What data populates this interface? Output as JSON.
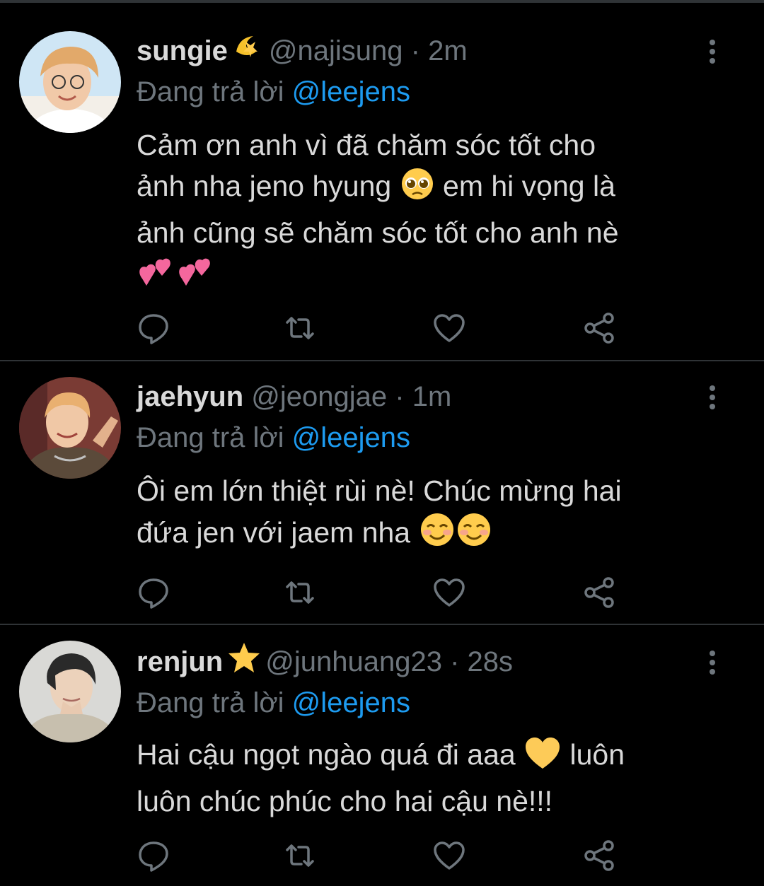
{
  "colors": {
    "background": "#000000",
    "text": "#d9d9d9",
    "secondary": "#6e767d",
    "mention": "#1d9bf0",
    "divider": "#2f3336"
  },
  "tweets": [
    {
      "display_name": "sungie",
      "badge_icon": "dizzy-emoji",
      "handle": "@najisung",
      "time": "· 2m",
      "replying_prefix": "Đang trả lời",
      "replying_to": "@leejens",
      "lines": [
        "Cảm ơn anh vì đã chăm sóc tốt cho",
        "ảnh nha jeno hyung",
        "em hi vọng là",
        "ảnh cũng sẽ chăm sóc tốt cho anh nè"
      ],
      "emojis": [
        "pleading-face-emoji",
        "two-hearts-emoji",
        "two-hearts-emoji"
      ]
    },
    {
      "display_name": "jaehyun",
      "handle": "@jeongjae",
      "time": "· 1m",
      "replying_prefix": "Đang trả lời",
      "replying_to": "@leejens",
      "lines": [
        "Ôi em lớn thiệt rùi nè! Chúc mừng hai",
        "đứa jen với jaem nha"
      ],
      "emojis": [
        "smiling-face-emoji",
        "smiling-face-emoji"
      ]
    },
    {
      "display_name": "renjun",
      "badge_icon": "star-emoji",
      "handle": "@junhuang23",
      "time": "· 28s",
      "replying_prefix": "Đang trả lời",
      "replying_to": "@leejens",
      "lines": [
        "Hai cậu ngọt ngào quá đi aaa",
        "luôn",
        "luôn chúc phúc cho hai cậu nè!!!"
      ],
      "emojis": [
        "yellow-heart-emoji"
      ]
    }
  ],
  "action_icons": [
    "reply-icon",
    "retweet-icon",
    "like-icon",
    "share-icon"
  ]
}
